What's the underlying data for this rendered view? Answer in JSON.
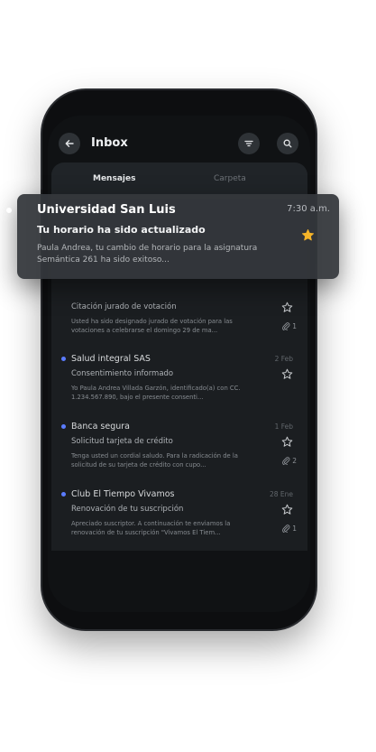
{
  "header": {
    "title": "Inbox",
    "back_icon": "arrow-left-icon",
    "filter_icon": "filter-icon",
    "search_icon": "search-icon"
  },
  "tabs": [
    {
      "label": "Mensajes",
      "active": true
    },
    {
      "label": "Carpeta",
      "active": false
    }
  ],
  "notification": {
    "sender": "Universidad San Luis",
    "time": "7:30 a.m.",
    "subject": "Tu horario ha sido actualizado",
    "preview": "Paula Andrea, tu cambio de horario para la asignatura Semántica 261 ha sido exitoso...",
    "starred": true,
    "star_color": "#f5b429"
  },
  "emails": [
    {
      "sender": "",
      "date": "",
      "subject": "Citación jurado de votación",
      "preview": "Usted ha sido designado jurado de votación para las votaciones a celebrarse el domingo 29 de ma...",
      "attachments": "1",
      "unread": false
    },
    {
      "sender": "Salud integral SAS",
      "date": "2 Feb",
      "subject": "Consentimiento informado",
      "preview": "Yo Paula Andrea Villada Garzón, identificado(a) con CC. 1.234.567.890, bajo el presente consenti...",
      "attachments": "",
      "unread": true
    },
    {
      "sender": "Banca segura",
      "date": "1 Feb",
      "subject": "Solicitud tarjeta de crédito",
      "preview": "Tenga usted un cordial saludo. Para la radicación de la solicitud de su tarjeta de crédito con cupo...",
      "attachments": "2",
      "unread": true
    },
    {
      "sender": "Club El Tiempo Vivamos",
      "date": "28 Ene",
      "subject": "Renovación de tu suscripción",
      "preview": "Apreciado suscriptor. A continuación te enviamos la renovación de tu suscripción \"Vivamos El Tiem...",
      "attachments": "1",
      "unread": true
    }
  ],
  "colors": {
    "unread_dot": "#5b7cff",
    "background": "#101214",
    "card": "#1b1e21"
  }
}
